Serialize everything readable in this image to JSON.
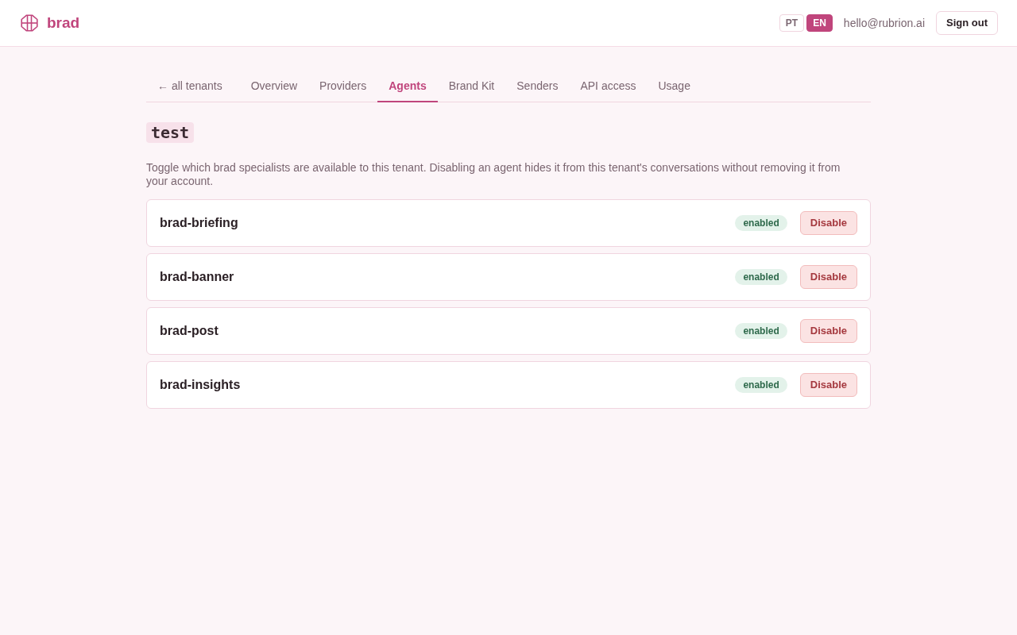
{
  "header": {
    "logo_text": "brad",
    "languages": [
      {
        "label": "PT",
        "selected": false
      },
      {
        "label": "EN",
        "selected": true
      }
    ],
    "email": "hello@rubrion.ai",
    "sign_out": "Sign out"
  },
  "nav": {
    "back_link": "← all tenants",
    "tabs": [
      {
        "label": "Overview",
        "selected": false
      },
      {
        "label": "Providers",
        "selected": false
      },
      {
        "label": "Agents",
        "selected": true
      },
      {
        "label": "Brand Kit",
        "selected": false
      },
      {
        "label": "Senders",
        "selected": false
      },
      {
        "label": "API access",
        "selected": false
      },
      {
        "label": "Usage",
        "selected": false
      }
    ]
  },
  "tenant_name": "test",
  "description": "Toggle which brad specialists are available to this tenant. Disabling an agent hides it from this tenant's conversations without removing it from your account.",
  "agents": [
    {
      "name": "brad-briefing",
      "enabled": true,
      "status": "enabled",
      "action": "Disable"
    },
    {
      "name": "brad-banner",
      "enabled": true,
      "status": "enabled",
      "action": "Disable"
    },
    {
      "name": "brad-post",
      "enabled": true,
      "status": "enabled",
      "action": "Disable"
    },
    {
      "name": "brad-insights",
      "enabled": true,
      "status": "enabled",
      "action": "Disable"
    }
  ]
}
